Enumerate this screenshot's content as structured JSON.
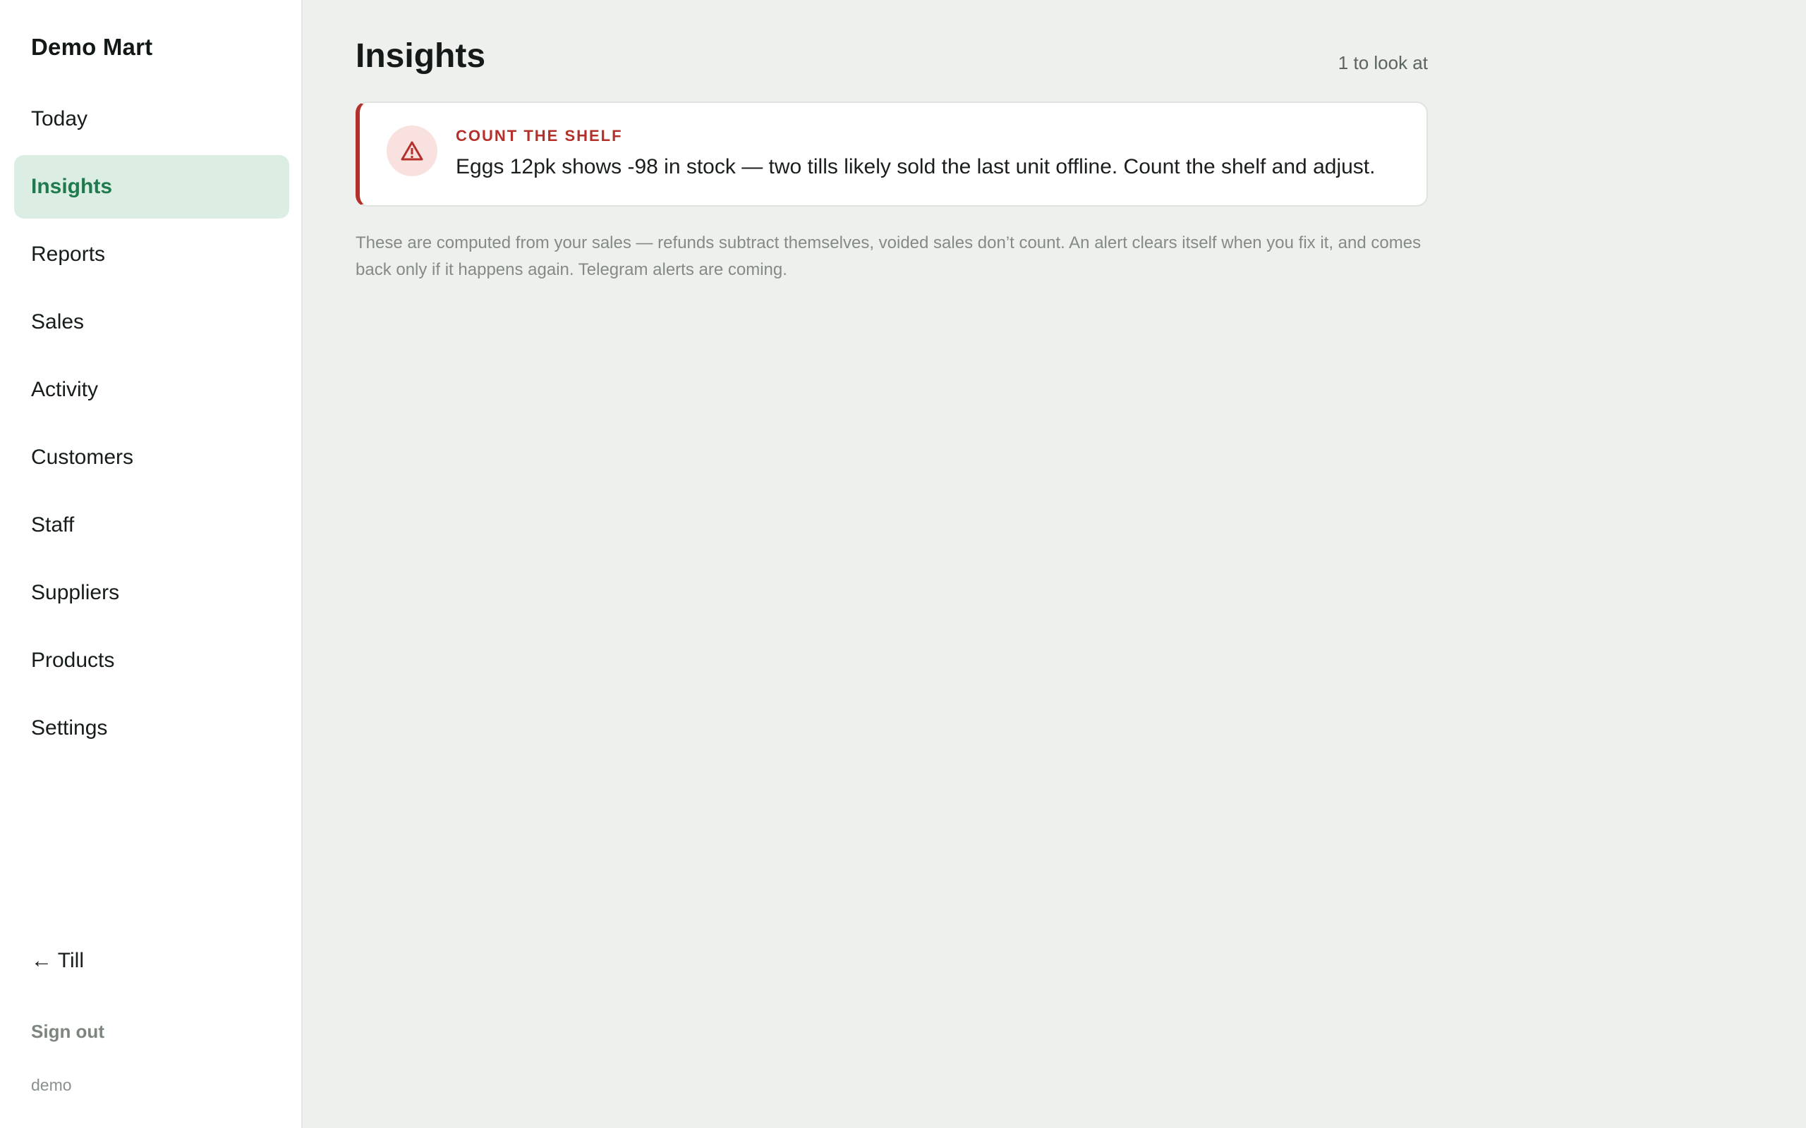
{
  "sidebar": {
    "brand": "Demo Mart",
    "items": [
      {
        "label": "Today"
      },
      {
        "label": "Insights"
      },
      {
        "label": "Reports"
      },
      {
        "label": "Sales"
      },
      {
        "label": "Activity"
      },
      {
        "label": "Customers"
      },
      {
        "label": "Staff"
      },
      {
        "label": "Suppliers"
      },
      {
        "label": "Products"
      },
      {
        "label": "Settings"
      }
    ],
    "active_item": "Insights",
    "till_link": "← Till",
    "sign_out": "Sign out",
    "user": "demo"
  },
  "main": {
    "title": "Insights",
    "count": "1 to look at",
    "alert": {
      "icon": "warning-triangle-icon",
      "label": "COUNT THE SHELF",
      "text": "Eggs 12pk shows -98 in stock — two tills likely sold the last unit offline. Count the shelf and adjust."
    },
    "footnote": "These are computed from your sales — refunds subtract themselves, voided sales don’t count. An alert clears itself when you fix it, and comes back only if it happens again. Telegram alerts are coming."
  },
  "colors": {
    "accent": "#1f7a4d",
    "active_bg": "#dcede4",
    "alert_red": "#b3302b",
    "page_bg": "#eef0ed"
  }
}
